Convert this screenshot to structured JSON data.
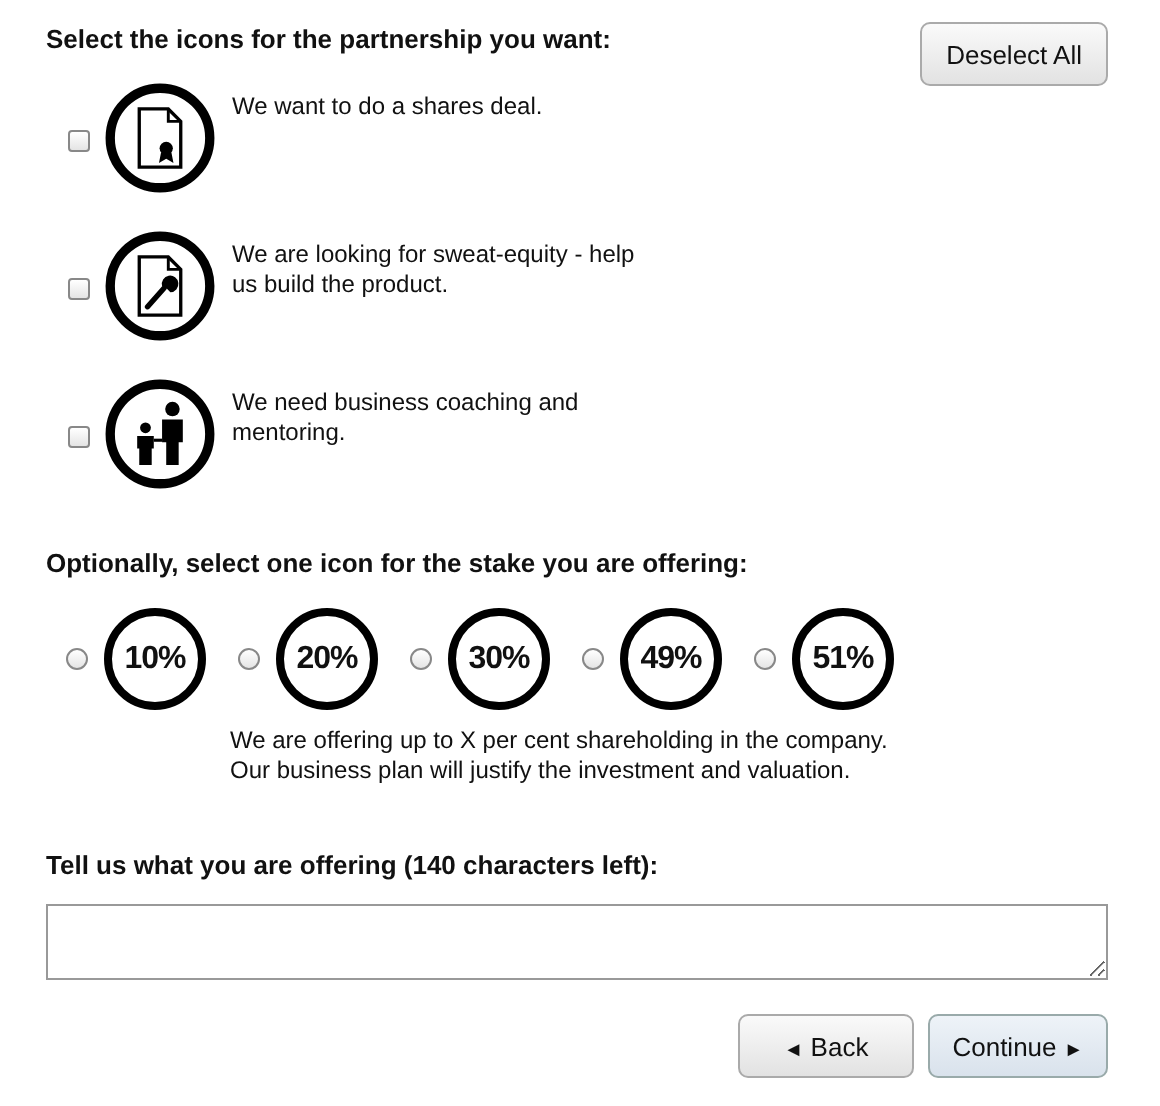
{
  "partnership": {
    "heading": "Select the icons for the partnership you want:",
    "deselect_button": "Deselect All",
    "options": [
      {
        "kind": "certificate",
        "text": "We want to do a shares deal.",
        "checked": false
      },
      {
        "kind": "wrench",
        "text": "We are looking for sweat-equity - help us build the product.",
        "checked": false
      },
      {
        "kind": "people",
        "text": "We need business coaching and mentoring.",
        "checked": false
      }
    ]
  },
  "stake": {
    "heading": "Optionally, select one icon for the stake you are offering:",
    "options": [
      {
        "label": "10%",
        "selected": false
      },
      {
        "label": "20%",
        "selected": false
      },
      {
        "label": "30%",
        "selected": false
      },
      {
        "label": "49%",
        "selected": false
      },
      {
        "label": "51%",
        "selected": false
      }
    ],
    "description": "We are offering up to X per cent shareholding in the company. Our business plan will justify the investment and valuation."
  },
  "offer": {
    "heading": "Tell us what you are offering (140 characters left):"
  },
  "buttons": [
    {
      "kind": "back",
      "arrow": "◄",
      "label": "Back"
    },
    {
      "kind": "continue",
      "arrow": "►",
      "label": "Continue"
    }
  ]
}
